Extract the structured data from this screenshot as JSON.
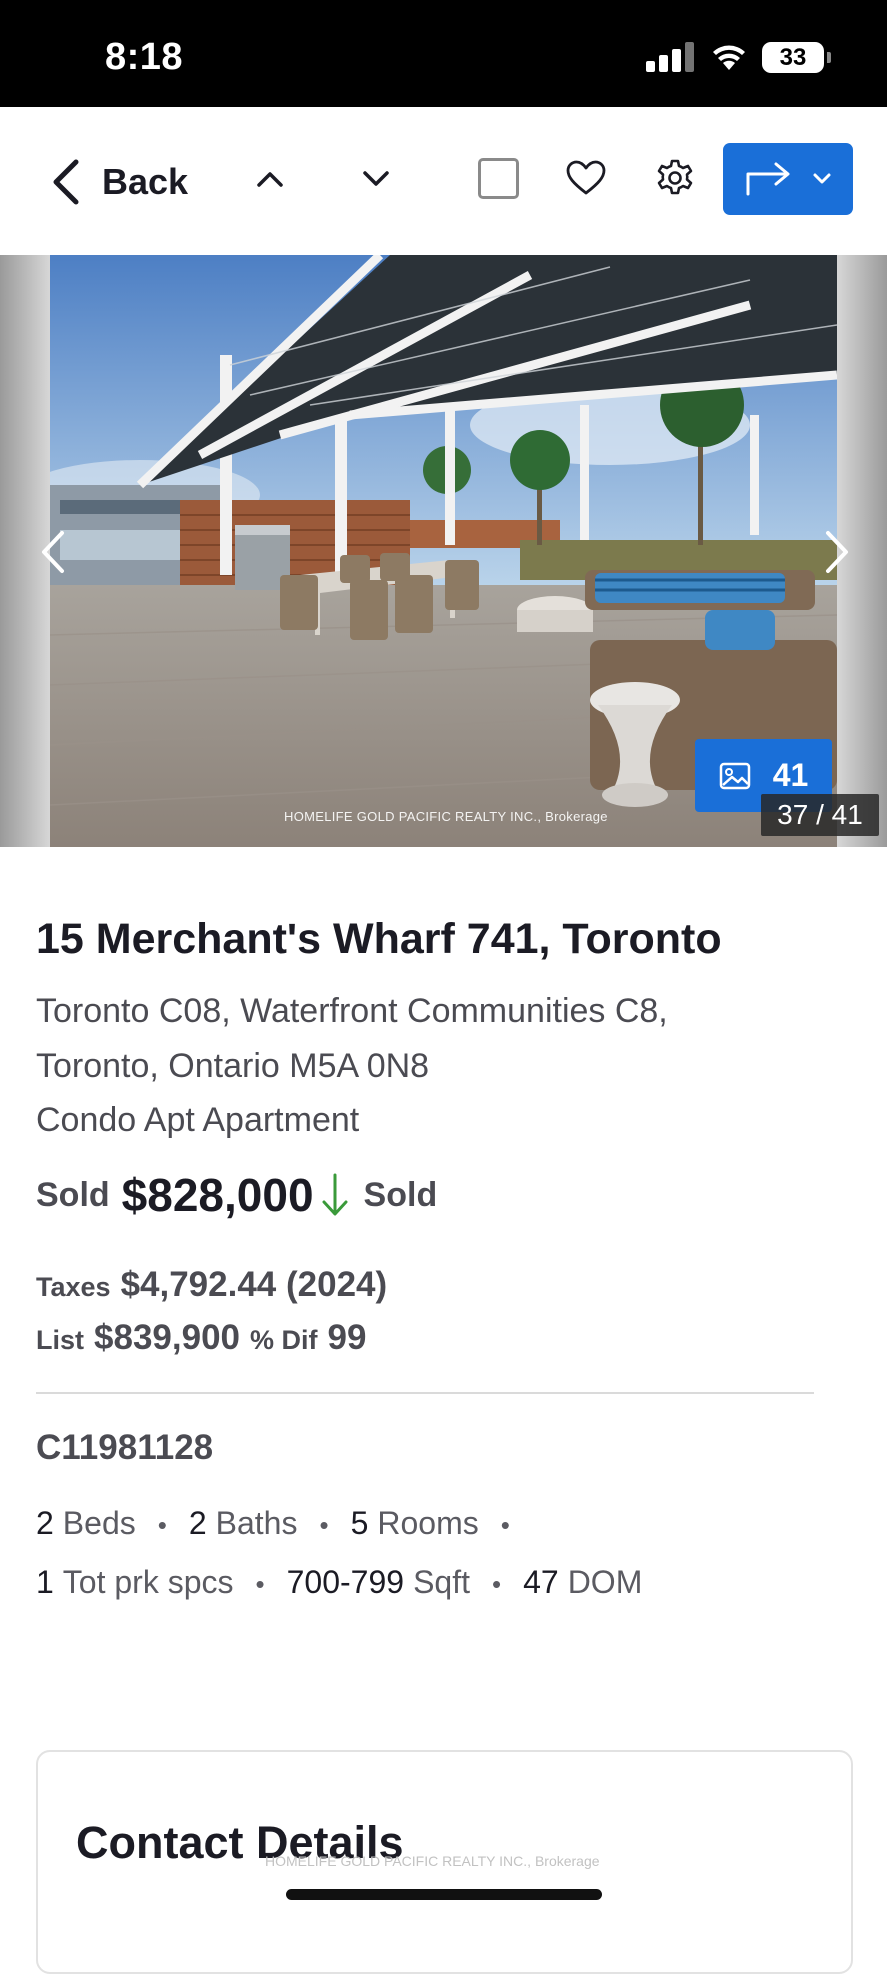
{
  "status_bar": {
    "time": "8:18",
    "battery": "33"
  },
  "toolbar": {
    "back_label": "Back"
  },
  "carousel": {
    "watermark": "HOMELIFE GOLD PACIFIC REALTY INC., Brokerage",
    "photo_count": "41",
    "counter": "37 / 41"
  },
  "listing": {
    "title": "15 Merchant's Wharf 741, Toronto",
    "address_line1": "Toronto C08, Waterfront Communities C8,",
    "address_line2": "Toronto, Ontario M5A 0N8",
    "type": "Condo Apt Apartment",
    "price_label": "Sold",
    "price": "$828,000",
    "status": "Sold",
    "taxes_label": "Taxes",
    "taxes_value": "$4,792.44 (2024)",
    "list_label": "List",
    "list_value": "$839,900",
    "dif_label": "% Dif",
    "dif_value": "99",
    "mls": "C11981128",
    "features_row1": [
      {
        "num": "2",
        "label": "Beds"
      },
      {
        "num": "2",
        "label": "Baths"
      },
      {
        "num": "5",
        "label": "Rooms"
      }
    ],
    "features_row2": [
      {
        "num": "1",
        "label": "Tot prk spcs"
      },
      {
        "num": "700-799",
        "label": "Sqft"
      },
      {
        "num": "47",
        "label": "DOM"
      }
    ],
    "bullet": "•"
  },
  "contact": {
    "title": "Contact Details",
    "watermark": "HOMELIFE GOLD PACIFIC REALTY INC., Brokerage"
  },
  "colors": {
    "accent": "#1a6fd8",
    "price_down": "#3a9a3a"
  }
}
